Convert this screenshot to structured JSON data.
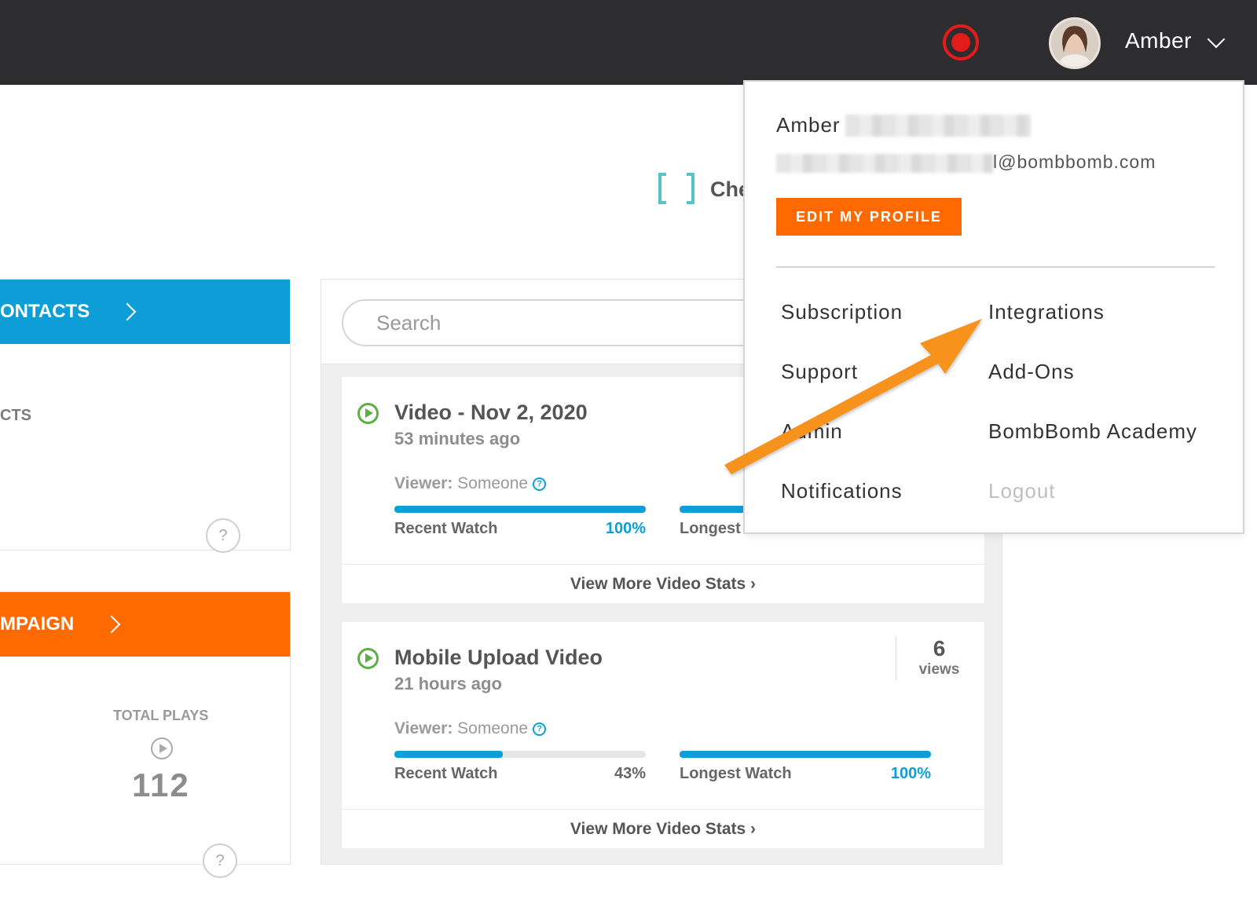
{
  "header": {
    "record_icon": "record-icon",
    "user_name": "Amber",
    "avatar_icon": "user-avatar"
  },
  "check_area": {
    "text": "Che"
  },
  "left": {
    "contacts_card": {
      "title": "ONTACTS",
      "subtitle": "CTS"
    },
    "campaign_card": {
      "title": "MPAIGN",
      "total_plays_label": "TOTAL PLAYS",
      "total_plays_value": "112"
    },
    "help_icon_text": "?"
  },
  "search": {
    "placeholder": "Search"
  },
  "videos": [
    {
      "title": "Video - Nov 2, 2020",
      "time": "53 minutes ago",
      "viewer_label": "Viewer:",
      "viewer_value": "Someone",
      "recent_label": "Recent Watch",
      "recent_pct": "100%",
      "recent_value": 100,
      "longest_label": "Longest",
      "longest_value": 100,
      "more_stats": "View More Video Stats ›"
    },
    {
      "title": "Mobile Upload Video",
      "time": "21 hours ago",
      "viewer_label": "Viewer:",
      "viewer_value": "Someone",
      "views_count": "6",
      "views_label": "views",
      "recent_label": "Recent Watch",
      "recent_pct": "43%",
      "recent_value": 43,
      "longest_label": "Longest Watch",
      "longest_pct": "100%",
      "longest_value": 100,
      "more_stats": "View More Video Stats ›"
    }
  ],
  "dropdown": {
    "name": "Amber",
    "email_suffix": "l@bombbomb.com",
    "edit_button": "EDIT MY PROFILE",
    "items_left": [
      "Subscription",
      "Support",
      "Admin",
      "Notifications"
    ],
    "items_right": [
      "Integrations",
      "Add-Ons",
      "BombBomb Academy",
      "Logout"
    ]
  },
  "colors": {
    "topbar": "#2d2d2f",
    "accent_blue": "#0d9ed8",
    "accent_orange": "#ff6a00",
    "annotation_arrow": "#f7931e",
    "play_green": "#5bb042"
  }
}
